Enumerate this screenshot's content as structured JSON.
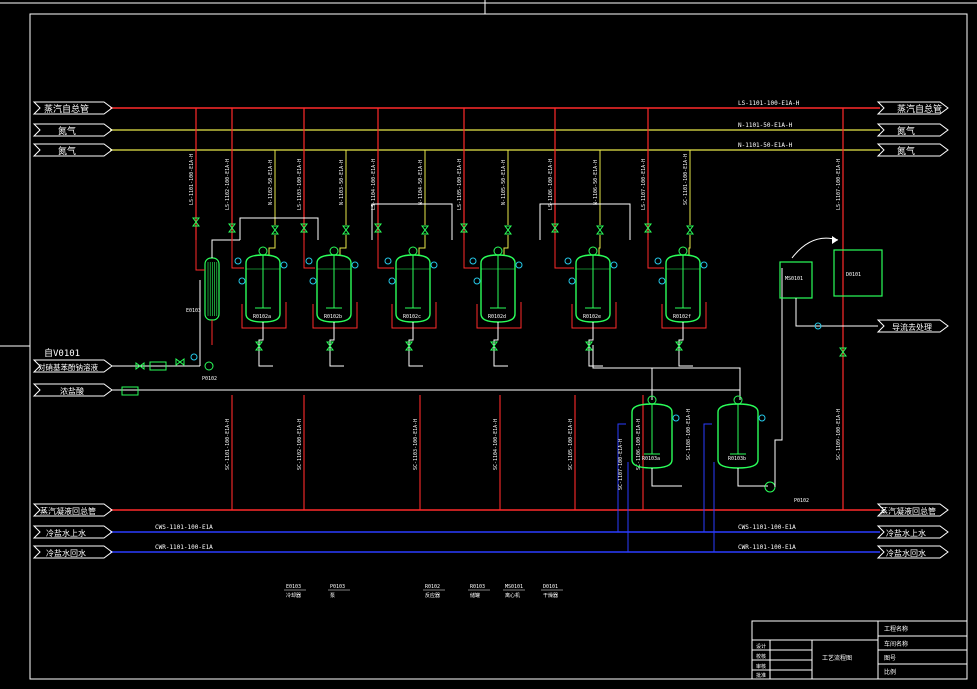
{
  "colors": {
    "background": "#000000",
    "frame": "#ffffff",
    "steam_line": "#ff2a2a",
    "nitrogen_line": "#e8e84a",
    "cooling_line": "#2a3cff",
    "process_line": "#ffffff",
    "equipment": "#2aff5a",
    "valve": "#2aff5a",
    "instrument": "#25c8e8",
    "label": "#ffffff"
  },
  "header_labels": {
    "steam_main": "蒸汽自总管",
    "nitrogen_1": "氮气",
    "nitrogen_2": "氮气"
  },
  "header_right_labels": {
    "steam_main": "蒸汽自总管",
    "nitrogen_1": "氮气",
    "nitrogen_2": "氮气",
    "off_gas": "导流去处理"
  },
  "header_line_codes": {
    "steam_main": "LS-1101-100-E1A-H",
    "nitrogen_1": "N-1101-50-E1A-H",
    "nitrogen_2": "N-1101-50-E1A-H"
  },
  "left_inputs": {
    "from_vessel_tag": "自V0101",
    "feed": "对硝基苯酚钠溶液",
    "acid": "浓盐酸"
  },
  "bottom_headers": {
    "condensate": "蒸汽凝液回总管",
    "cooling_supply": "冷盐水上水",
    "cooling_return": "冷盐水回水"
  },
  "bottom_line_codes": {
    "cooling_supply": "CWS-1101-100-E1A",
    "cooling_return": "CWR-1101-100-E1A"
  },
  "vertical_line_labels": [
    "LS-1101-100-E1A-H",
    "LS-1102-100-E1A-H",
    "N-1102-50-E1A-H",
    "LS-1103-100-E1A-H",
    "N-1103-50-E1A-H",
    "LS-1104-100-E1A-H",
    "N-1104-50-E1A-H",
    "LS-1105-100-E1A-H",
    "N-1105-50-E1A-H",
    "LS-1106-100-E1A-H",
    "N-1106-50-E1A-H",
    "LS-1107-100-E1A-H",
    "SC-1101-100-E1A-H",
    "SC-1102-100-E1A-H",
    "SC-1103-100-E1A-H",
    "SC-1104-100-E1A-H",
    "SC-1105-100-E1A-H",
    "SC-1106-100-E1A-H",
    "SC-1107-100-E1A-H",
    "SC-1108-100-E1A-H",
    "SC-1109-100-E1A-H"
  ],
  "equipment": {
    "exchanger": "E0103",
    "pump_feed": "P0102",
    "pump_bottom": "P0102",
    "reactors": [
      "R0102a",
      "R0102b",
      "R0102c",
      "R0102d",
      "R0102e",
      "R0102f"
    ],
    "tanks": [
      "R0103a",
      "R0103b"
    ],
    "separator": "MS0101",
    "dryer": "D0101"
  },
  "legend": [
    {
      "tag": "E0103",
      "desc": "冷却器"
    },
    {
      "tag": "P0103",
      "desc": "泵"
    },
    {
      "tag": "R0102",
      "desc": "反应器"
    },
    {
      "tag": "R0103",
      "desc": "储罐"
    },
    {
      "tag": "MS0101",
      "desc": "离心机"
    },
    {
      "tag": "D0101",
      "desc": "干燥器"
    }
  ],
  "title_block": {
    "project": "工程名称",
    "subproject": "车间名称",
    "drawing_title": "工艺流程图",
    "row1": "设计",
    "row2": "校核",
    "row3": "审核",
    "row4": "批准",
    "sheet1": "图号",
    "sheet2": "比例"
  }
}
